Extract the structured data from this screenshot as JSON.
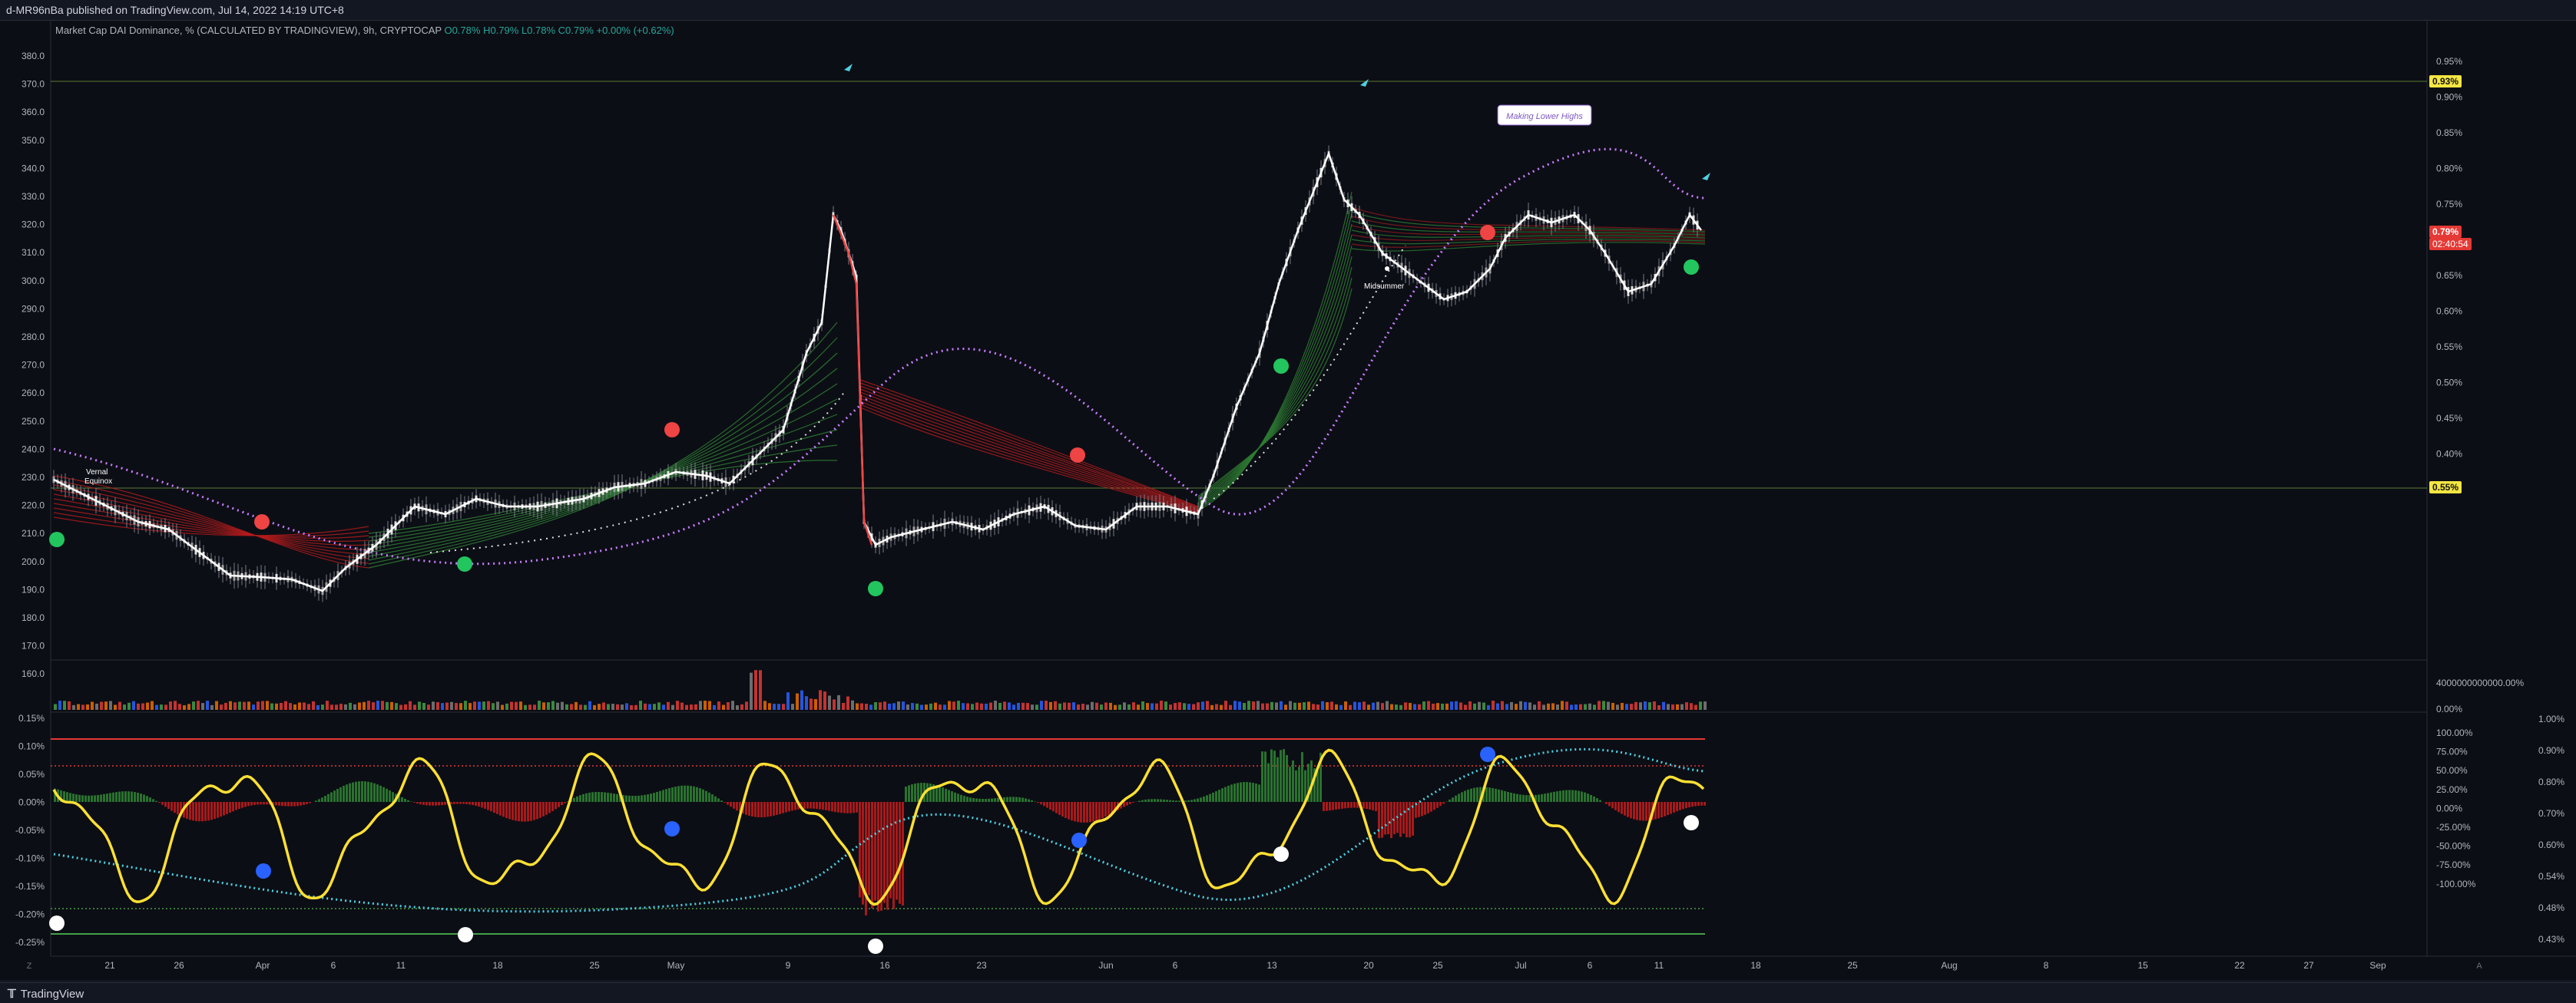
{
  "header": {
    "published": "d-MR96nBa published on TradingView.com, Jul 14, 2022 14:19 UTC+8"
  },
  "legend": {
    "title": "Market Cap DAI Dominance, % (CALCULATED BY TRADINGVIEW), 9h, CRYPTOCAP",
    "o": "O0.78%",
    "h": "H0.79%",
    "l": "L0.78%",
    "c": "C0.79%",
    "chg": "+0.00% (+0.62%)"
  },
  "annotations": {
    "making_lower_highs": "Making Lower Highs",
    "vernal_equinox_1": "Vernal",
    "vernal_equinox_2": "Equinox",
    "midsummer": "Midsummer"
  },
  "price_badges": {
    "top": "0.93%",
    "current": "0.79%",
    "countdown": "02:40:54",
    "mid": "0.55%"
  },
  "left_axis_main": [
    "380.0",
    "370.0",
    "360.0",
    "350.0",
    "340.0",
    "330.0",
    "320.0",
    "310.0",
    "300.0",
    "290.0",
    "280.0",
    "270.0",
    "260.0",
    "250.0",
    "240.0",
    "230.0",
    "220.0",
    "210.0",
    "200.0",
    "190.0",
    "180.0",
    "170.0",
    "160.0"
  ],
  "right_axis_main": [
    "0.95%",
    "0.90%",
    "0.85%",
    "0.80%",
    "0.75%",
    "0.70%",
    "0.65%",
    "0.60%",
    "0.55%",
    "0.50%",
    "0.45%",
    "0.40%"
  ],
  "volume_axis": [
    "4000000000000.00%",
    "0.00%"
  ],
  "left_axis_osc": [
    "0.15%",
    "0.10%",
    "0.05%",
    "0.00%",
    "-0.05%",
    "-0.10%",
    "-0.15%",
    "-0.20%",
    "-0.25%"
  ],
  "right_axis_osc": [
    "100.00%",
    "75.00%",
    "50.00%",
    "25.00%",
    "0.00%",
    "-25.00%",
    "-50.00%",
    "-75.00%",
    "-100.00%"
  ],
  "far_right_axis_osc": [
    "1.00%",
    "0.90%",
    "0.80%",
    "0.70%",
    "0.60%",
    "0.54%",
    "0.48%",
    "0.43%"
  ],
  "time_axis": [
    "21",
    "26",
    "Apr",
    "6",
    "11",
    "18",
    "25",
    "May",
    "9",
    "16",
    "23",
    "Jun",
    "6",
    "13",
    "20",
    "25",
    "Jul",
    "6",
    "11",
    "18",
    "25",
    "Aug",
    "8",
    "15",
    "22",
    "27",
    "Sep"
  ],
  "time_axis_corners": {
    "left": "Z",
    "right": "A"
  },
  "brand": "TradingView",
  "colors": {
    "background": "#0c0e15",
    "price_line": "#ffffff",
    "bull": "#22c55e",
    "bear": "#ef4444",
    "oscillator": "#ffe033",
    "dotted_ma": "#c77dff",
    "teal_ma": "#4dd0e1"
  }
}
